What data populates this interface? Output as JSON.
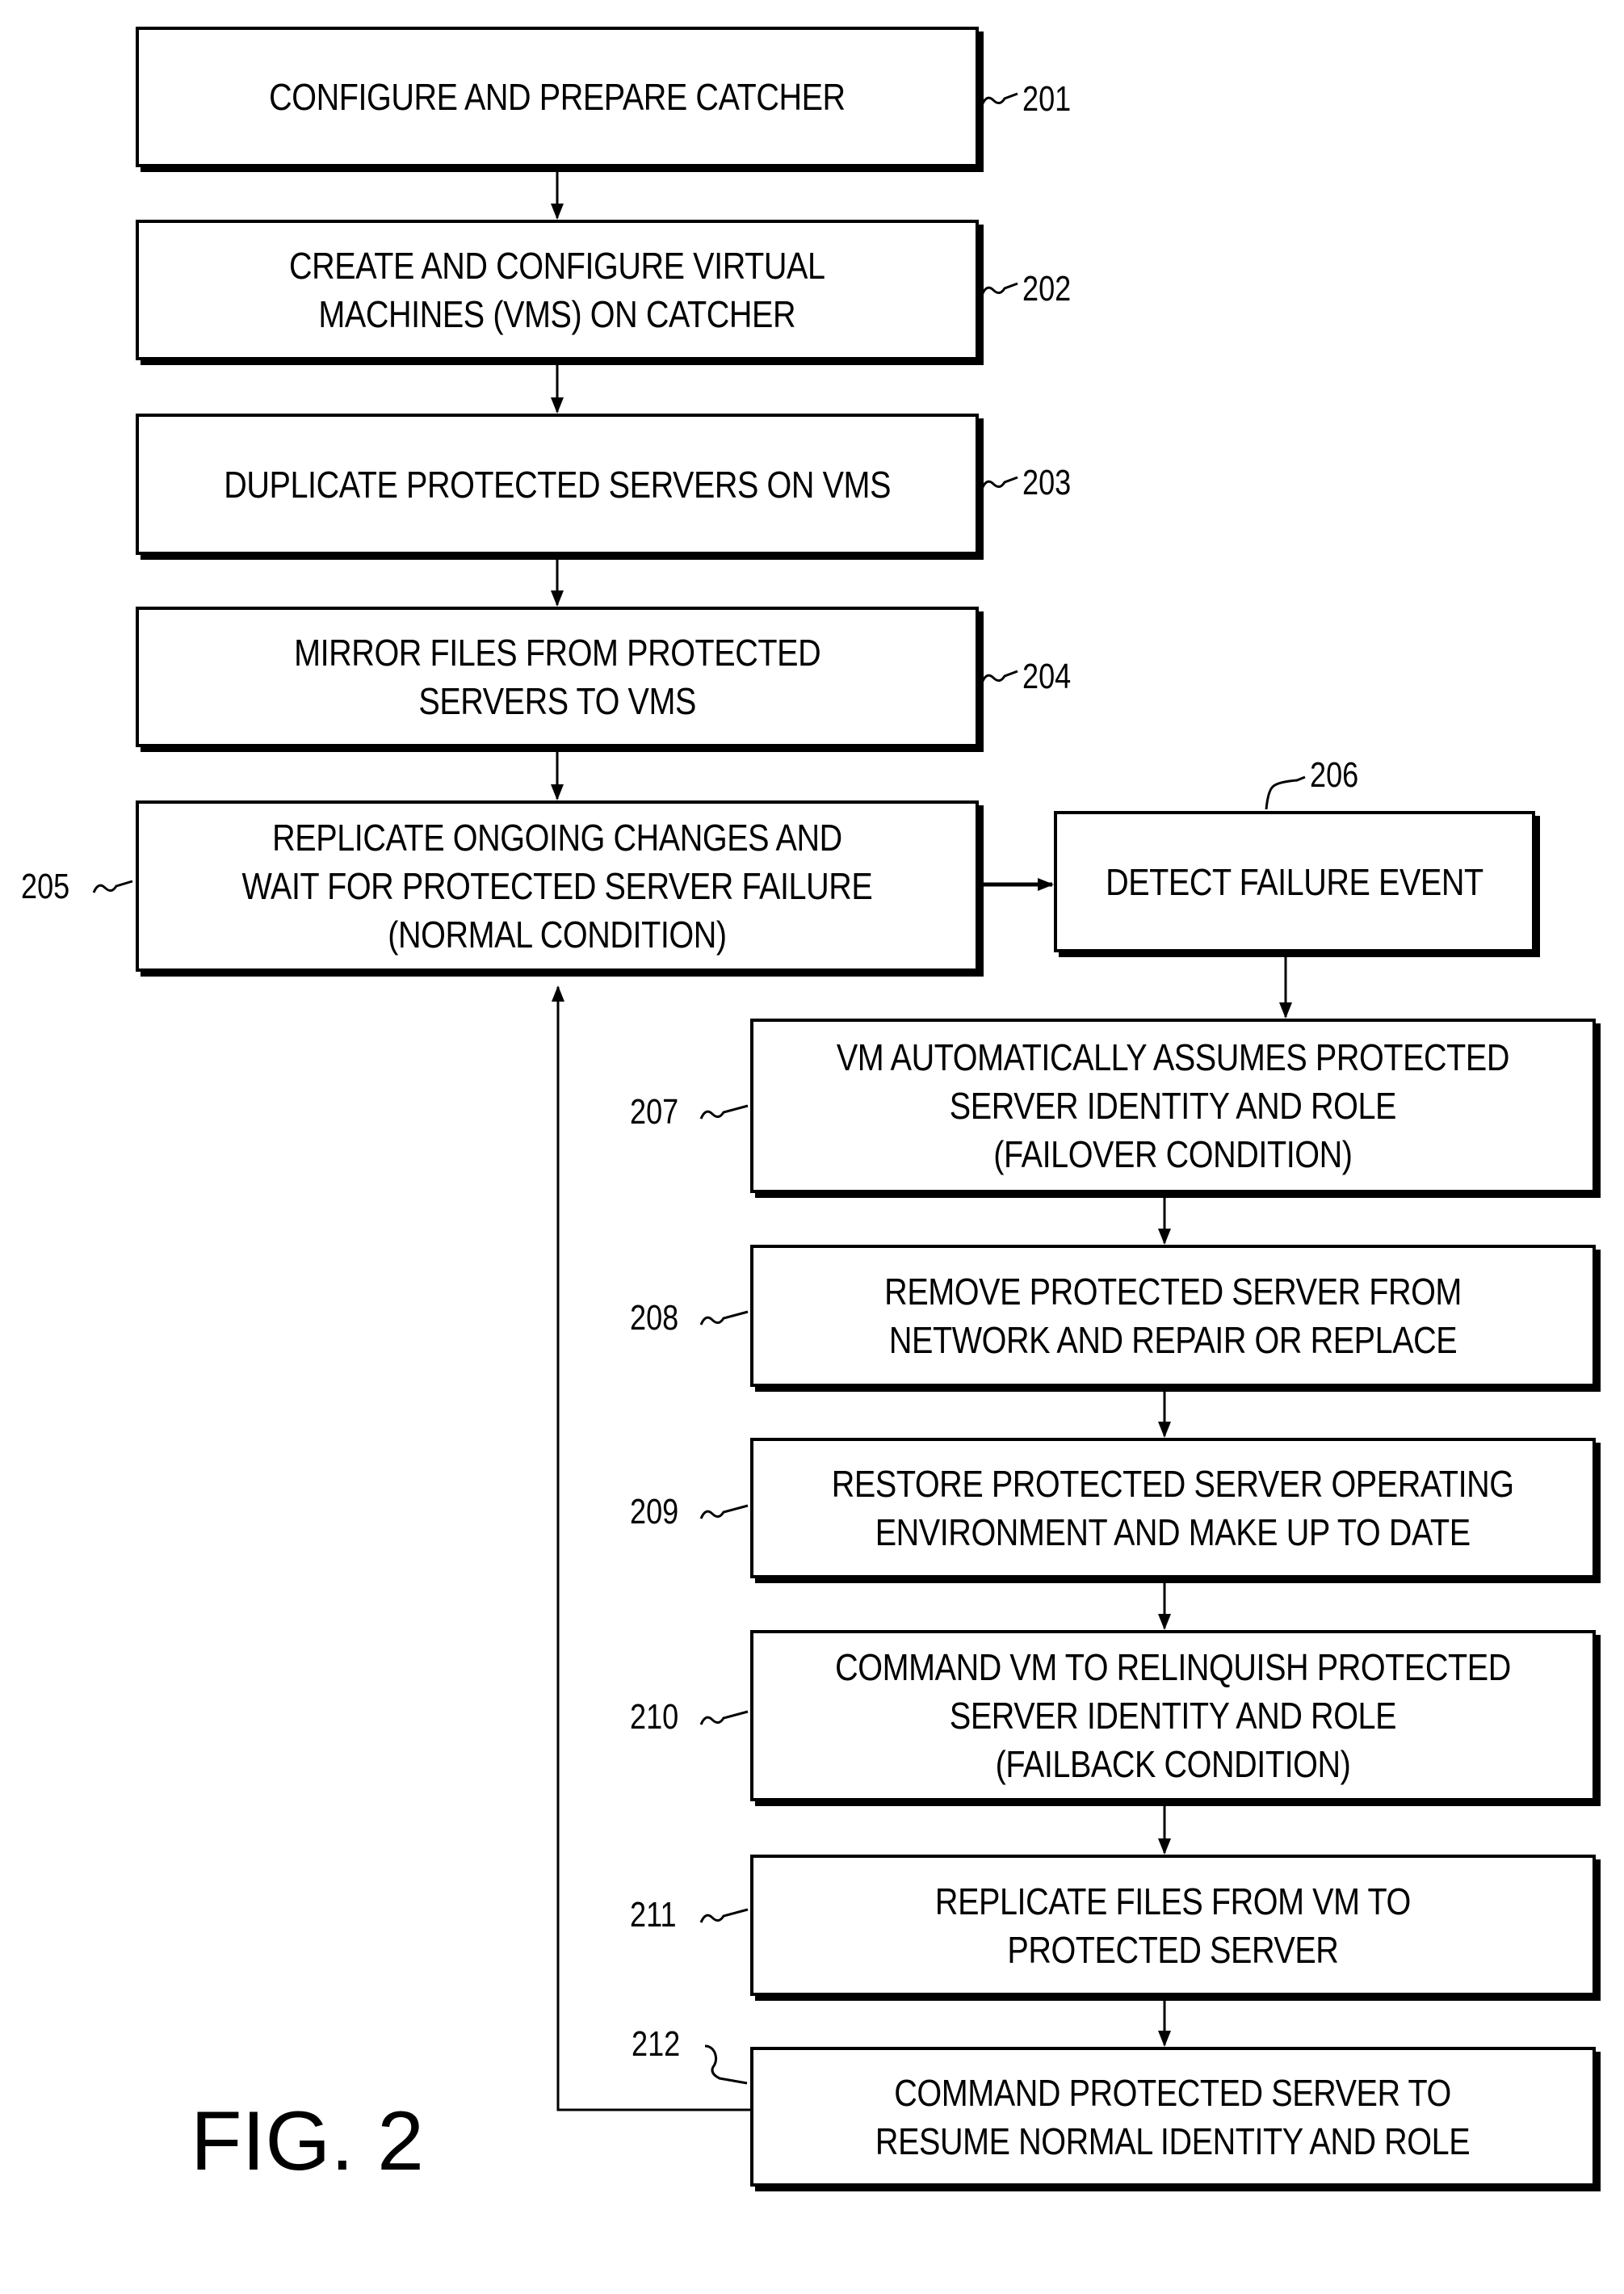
{
  "diagram": {
    "figure_label": "FIG. 2",
    "steps": [
      {
        "ref": "201",
        "text": "CONFIGURE AND PREPARE CATCHER"
      },
      {
        "ref": "202",
        "text": "CREATE AND CONFIGURE VIRTUAL\nMACHINES (VMS) ON CATCHER"
      },
      {
        "ref": "203",
        "text": "DUPLICATE PROTECTED SERVERS ON VMS"
      },
      {
        "ref": "204",
        "text": "MIRROR FILES FROM PROTECTED\nSERVERS TO VMS"
      },
      {
        "ref": "205",
        "text": "REPLICATE ONGOING CHANGES AND\nWAIT FOR PROTECTED SERVER FAILURE\n(NORMAL CONDITION)"
      },
      {
        "ref": "206",
        "text": "DETECT FAILURE EVENT"
      },
      {
        "ref": "207",
        "text": "VM AUTOMATICALLY ASSUMES PROTECTED\nSERVER IDENTITY AND ROLE\n(FAILOVER CONDITION)"
      },
      {
        "ref": "208",
        "text": "REMOVE PROTECTED SERVER FROM\nNETWORK AND REPAIR OR REPLACE"
      },
      {
        "ref": "209",
        "text": "RESTORE PROTECTED SERVER OPERATING\nENVIRONMENT AND MAKE UP TO DATE"
      },
      {
        "ref": "210",
        "text": "COMMAND VM TO RELINQUISH PROTECTED\nSERVER IDENTITY AND ROLE\n(FAILBACK CONDITION)"
      },
      {
        "ref": "211",
        "text": "REPLICATE FILES FROM VM TO\nPROTECTED SERVER"
      },
      {
        "ref": "212",
        "text": "COMMAND PROTECTED SERVER TO\nRESUME NORMAL IDENTITY AND ROLE"
      }
    ],
    "connections": [
      {
        "from": "201",
        "to": "202"
      },
      {
        "from": "202",
        "to": "203"
      },
      {
        "from": "203",
        "to": "204"
      },
      {
        "from": "204",
        "to": "205"
      },
      {
        "from": "205",
        "to": "206"
      },
      {
        "from": "206",
        "to": "207"
      },
      {
        "from": "207",
        "to": "208"
      },
      {
        "from": "208",
        "to": "209"
      },
      {
        "from": "209",
        "to": "210"
      },
      {
        "from": "210",
        "to": "211"
      },
      {
        "from": "211",
        "to": "212"
      },
      {
        "from": "212",
        "to": "205"
      }
    ]
  }
}
